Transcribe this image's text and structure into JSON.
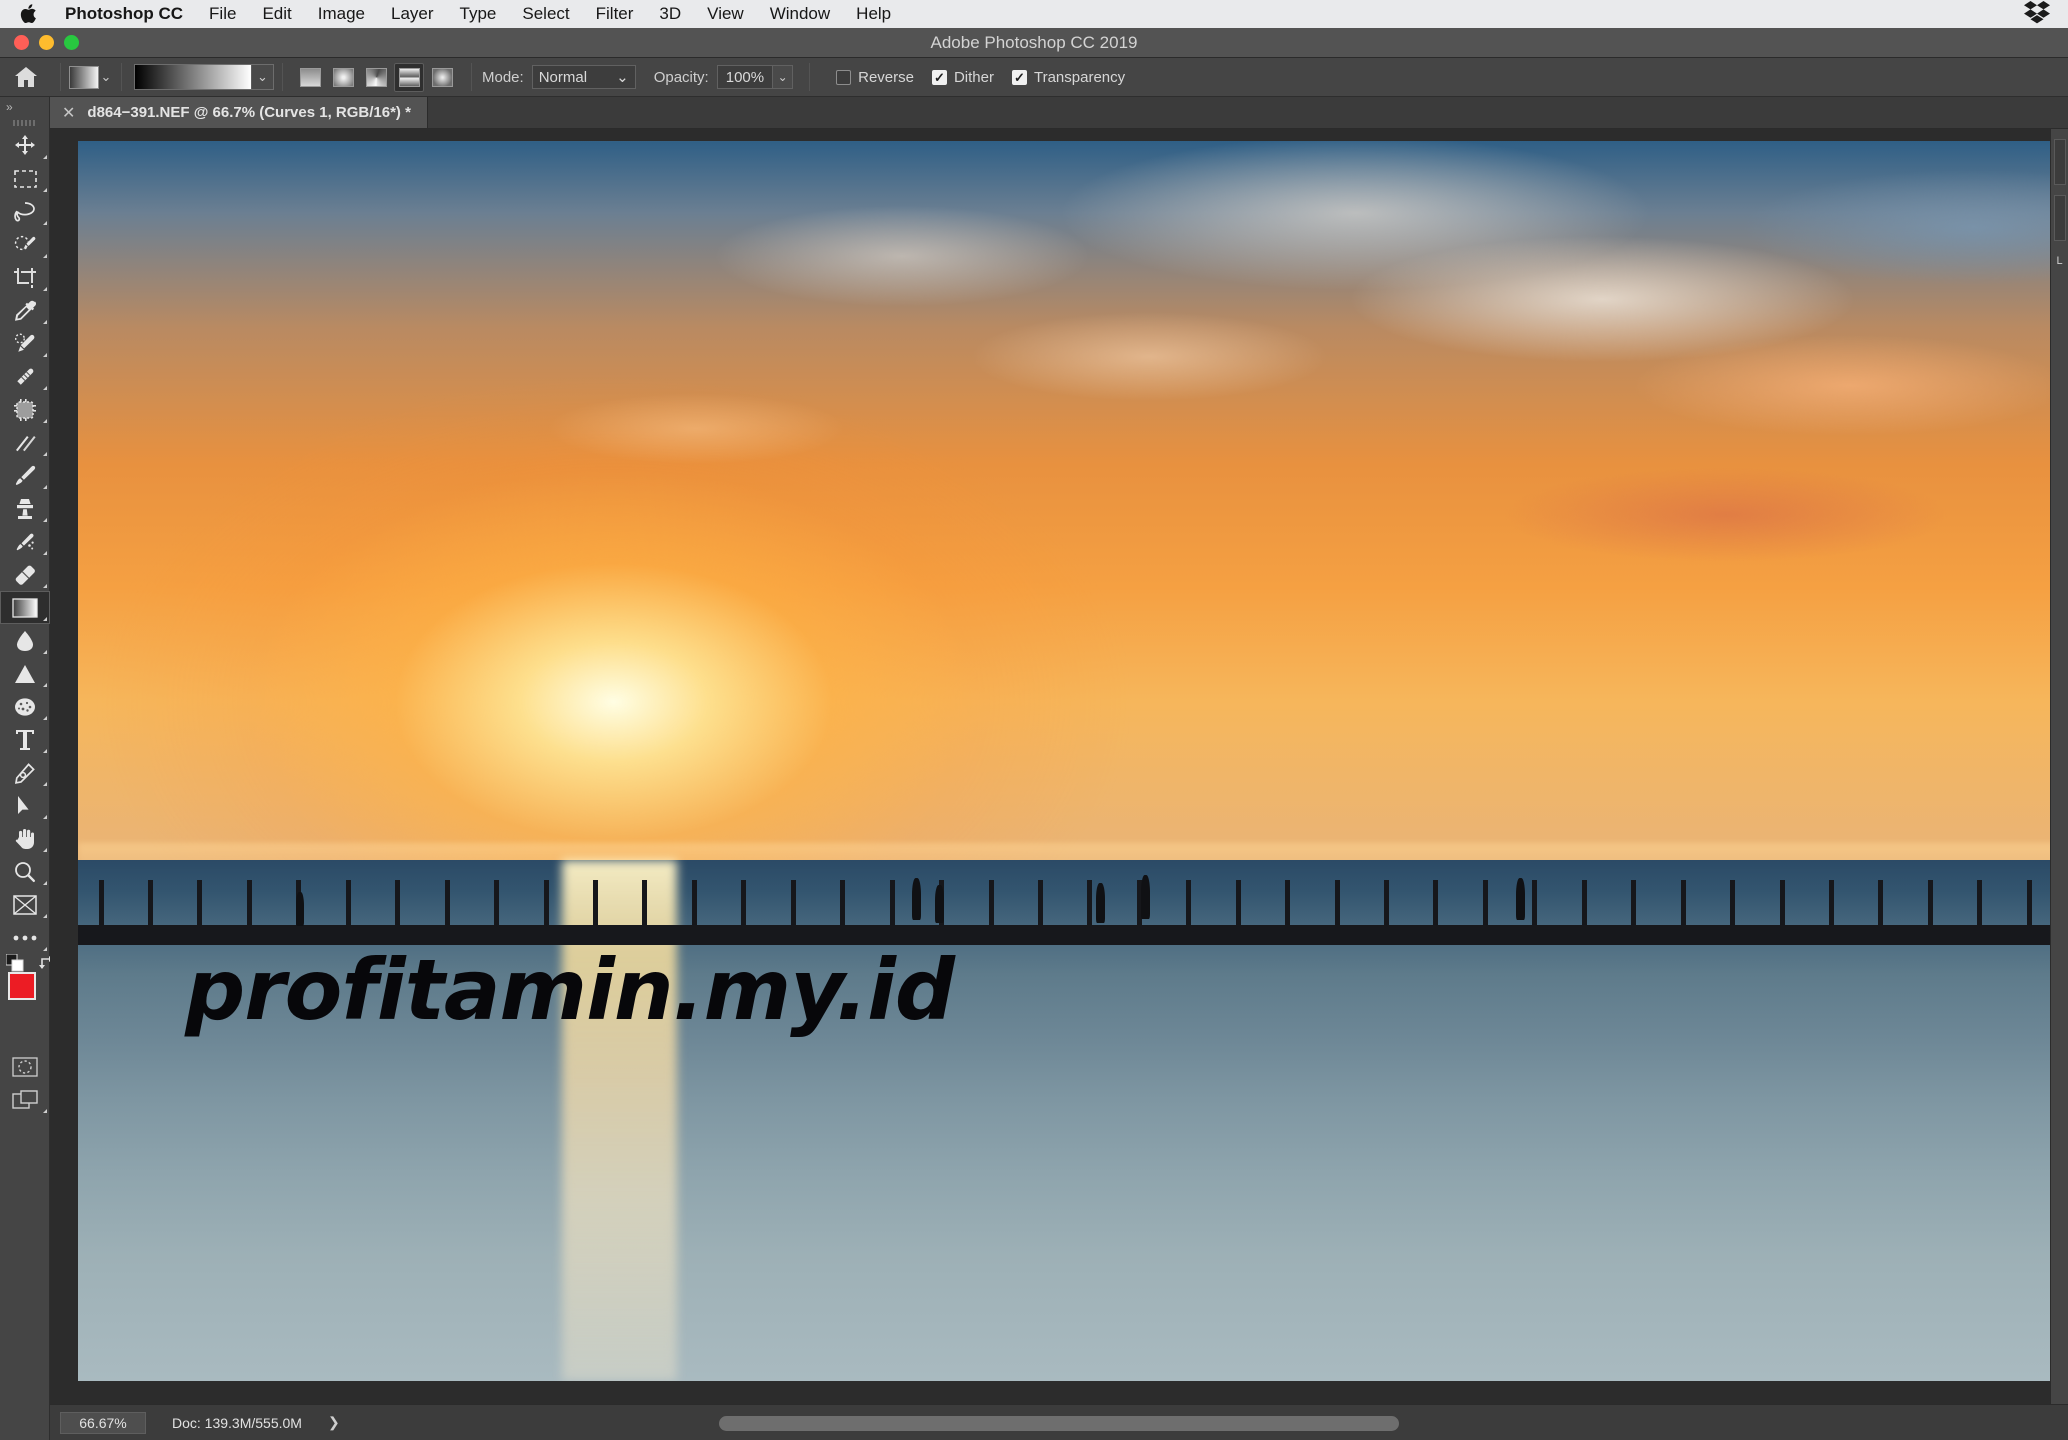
{
  "menubar": {
    "apple_icon": "apple-logo-icon",
    "items": [
      {
        "label": "Photoshop CC",
        "bold": true
      },
      {
        "label": "File"
      },
      {
        "label": "Edit"
      },
      {
        "label": "Image"
      },
      {
        "label": "Layer"
      },
      {
        "label": "Type"
      },
      {
        "label": "Select"
      },
      {
        "label": "Filter"
      },
      {
        "label": "3D"
      },
      {
        "label": "View"
      },
      {
        "label": "Window"
      },
      {
        "label": "Help"
      }
    ],
    "right_icons": [
      "dropbox-icon"
    ]
  },
  "window": {
    "title": "Adobe Photoshop CC 2019",
    "traffic_lights": [
      "close",
      "minimize",
      "zoom"
    ]
  },
  "options_bar": {
    "home_icon": "home-icon",
    "gradient_swatch_label": "gradient-preset-swatch",
    "gradient_preview_from": "#000000",
    "gradient_preview_to": "#ffffff",
    "gradient_types": [
      {
        "name": "linear-gradient-button",
        "selected": false
      },
      {
        "name": "radial-gradient-button",
        "selected": false
      },
      {
        "name": "angle-gradient-button",
        "selected": false
      },
      {
        "name": "reflected-gradient-button",
        "selected": true
      },
      {
        "name": "diamond-gradient-button",
        "selected": false
      }
    ],
    "mode_label": "Mode:",
    "mode_value": "Normal",
    "opacity_label": "Opacity:",
    "opacity_value": "100%",
    "checkboxes": [
      {
        "label": "Reverse",
        "checked": false
      },
      {
        "label": "Dither",
        "checked": true
      },
      {
        "label": "Transparency",
        "checked": true
      }
    ]
  },
  "tools": {
    "collapse_icon": "chevron-double-right-icon",
    "items": [
      {
        "name": "move-tool",
        "icon": "move-icon"
      },
      {
        "name": "rectangular-marquee-tool",
        "icon": "marquee-icon"
      },
      {
        "name": "lasso-tool",
        "icon": "lasso-icon"
      },
      {
        "name": "quick-selection-tool",
        "icon": "quick-selection-icon"
      },
      {
        "name": "crop-tool",
        "icon": "crop-icon"
      },
      {
        "name": "eyedropper-tool",
        "icon": "eyedropper-icon"
      },
      {
        "name": "spot-healing-brush-tool",
        "icon": "healing-brush-icon"
      },
      {
        "name": "patch-tool",
        "icon": "patch-icon"
      },
      {
        "name": "content-aware-move-tool",
        "icon": "content-aware-icon"
      },
      {
        "name": "red-eye-tool",
        "icon": "red-eye-icon"
      },
      {
        "name": "brush-tool",
        "icon": "brush-icon"
      },
      {
        "name": "clone-stamp-tool",
        "icon": "stamp-icon"
      },
      {
        "name": "history-brush-tool",
        "icon": "history-brush-icon"
      },
      {
        "name": "eraser-tool",
        "icon": "eraser-icon"
      },
      {
        "name": "gradient-tool",
        "icon": "gradient-icon",
        "selected": true
      },
      {
        "name": "blur-tool",
        "icon": "blur-drop-icon"
      },
      {
        "name": "dodge-tool",
        "icon": "dodge-icon"
      },
      {
        "name": "sponge-tool",
        "icon": "sponge-icon"
      },
      {
        "name": "type-tool",
        "icon": "type-t-icon"
      },
      {
        "name": "pen-tool",
        "icon": "pen-icon"
      },
      {
        "name": "path-selection-tool",
        "icon": "path-arrow-icon"
      },
      {
        "name": "hand-tool",
        "icon": "hand-icon"
      },
      {
        "name": "zoom-tool",
        "icon": "magnifier-icon"
      },
      {
        "name": "frame-tool",
        "icon": "frame-icon"
      },
      {
        "name": "edit-toolbar",
        "icon": "ellipsis-icon"
      }
    ],
    "swatches": {
      "foreground_color": "#ec1c24",
      "background_color": "#ffffff",
      "default_icon": "default-colors-icon",
      "swap_icon": "swap-colors-icon"
    },
    "modes": [
      {
        "name": "quick-mask-button",
        "icon": "quick-mask-icon"
      },
      {
        "name": "screen-mode-button",
        "icon": "screen-mode-icon"
      }
    ]
  },
  "document_tab": {
    "close_icon": "close-icon",
    "title": "d864−391.NEF @ 66.7% (Curves 1, RGB/16*) *"
  },
  "canvas": {
    "watermark": "profitamin.my.id",
    "image_description": "sunset-over-sea-with-pier-silhouette"
  },
  "status_bar": {
    "zoom_value": "66.67%",
    "doc_info": "Doc: 139.3M/555.0M",
    "expand_icon": "chevron-right-icon",
    "scrollbar": "horizontal-scrollbar"
  },
  "right_panel": {
    "label": "L",
    "tabs": [
      "panel-tab-1",
      "panel-tab-2"
    ]
  }
}
